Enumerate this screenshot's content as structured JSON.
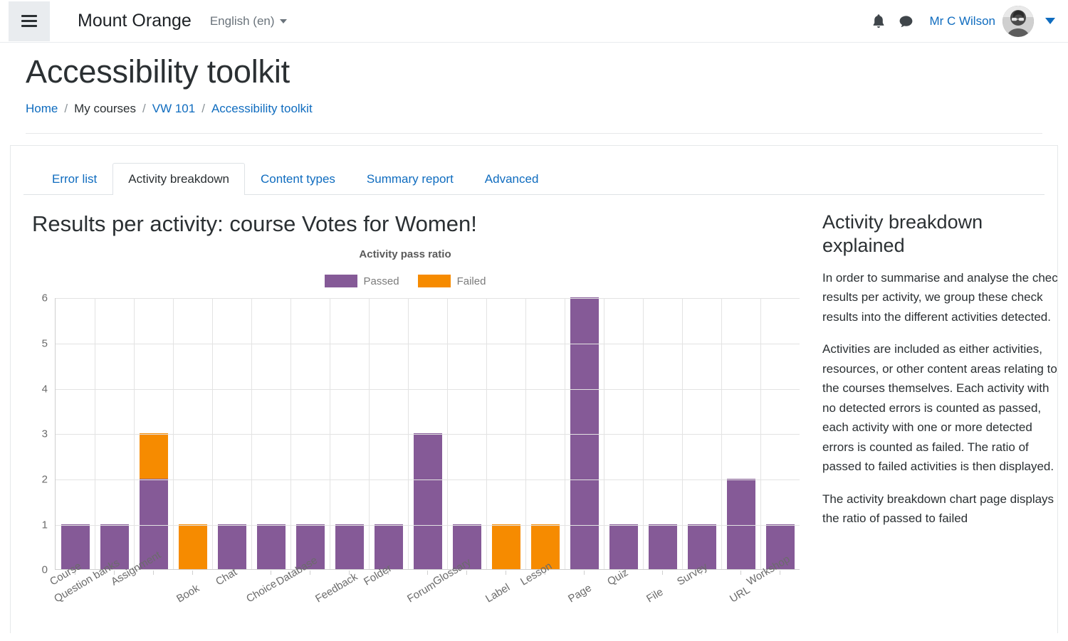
{
  "navbar": {
    "menu_icon": "hamburger-icon",
    "brand": "Mount Orange",
    "language": "English (en)",
    "notifications_icon": "bell-icon",
    "messages_icon": "message-bubble-icon",
    "user_name": "Mr C Wilson",
    "avatar": "user-avatar",
    "caret_icon": "chevron-down-icon"
  },
  "page": {
    "title": "Accessibility toolkit",
    "breadcrumb": [
      {
        "label": "Home",
        "link": true
      },
      {
        "label": "My courses",
        "link": false
      },
      {
        "label": "VW 101",
        "link": true
      },
      {
        "label": "Accessibility toolkit",
        "link": true
      }
    ],
    "breadcrumb_separator": "/"
  },
  "tabs": [
    {
      "label": "Error list",
      "active": false
    },
    {
      "label": "Activity breakdown",
      "active": true
    },
    {
      "label": "Content types",
      "active": false
    },
    {
      "label": "Summary report",
      "active": false
    },
    {
      "label": "Advanced",
      "active": false
    }
  ],
  "main": {
    "heading": "Results per activity: course Votes for Women!"
  },
  "chart_data": {
    "type": "bar",
    "stacked": true,
    "title": "Activity pass ratio",
    "xlabel": "",
    "ylabel": "",
    "ylim": [
      0,
      6
    ],
    "yticks": [
      0,
      1,
      2,
      3,
      4,
      5,
      6
    ],
    "grid": true,
    "legend_position": "top",
    "colors": {
      "passed": "#855A97",
      "failed": "#F68B00"
    },
    "categories": [
      "Course",
      "Question banks",
      "Assignment",
      "Book",
      "Chat",
      "Choice",
      "Database",
      "Feedback",
      "Folder",
      "Forum",
      "Glossary",
      "Label",
      "Lesson",
      "Page",
      "Quiz",
      "File",
      "Survey",
      "URL",
      "Workshop"
    ],
    "series": [
      {
        "name": "Passed",
        "color": "#855A97",
        "values": [
          1,
          1,
          2,
          0,
          1,
          1,
          1,
          1,
          1,
          3,
          1,
          0,
          0,
          6,
          1,
          1,
          1,
          2,
          1
        ]
      },
      {
        "name": "Failed",
        "color": "#F68B00",
        "values": [
          0,
          0,
          1,
          1,
          0,
          0,
          0,
          0,
          0,
          0,
          0,
          1,
          1,
          0,
          0,
          0,
          0,
          0,
          0
        ]
      }
    ]
  },
  "sidebar": {
    "title": "Activity breakdown explained",
    "paragraphs": [
      "In order to summarise and analyse the check results per activity, we group these check results into the different activities detected.",
      "Activities are included as either activities, resources, or other content areas relating to the courses themselves. Each activity with no detected errors is counted as passed, each activity with one or more detected errors is counted as failed. The ratio of passed to failed activities is then displayed.",
      "The activity breakdown chart page displays the ratio of passed to failed"
    ]
  }
}
